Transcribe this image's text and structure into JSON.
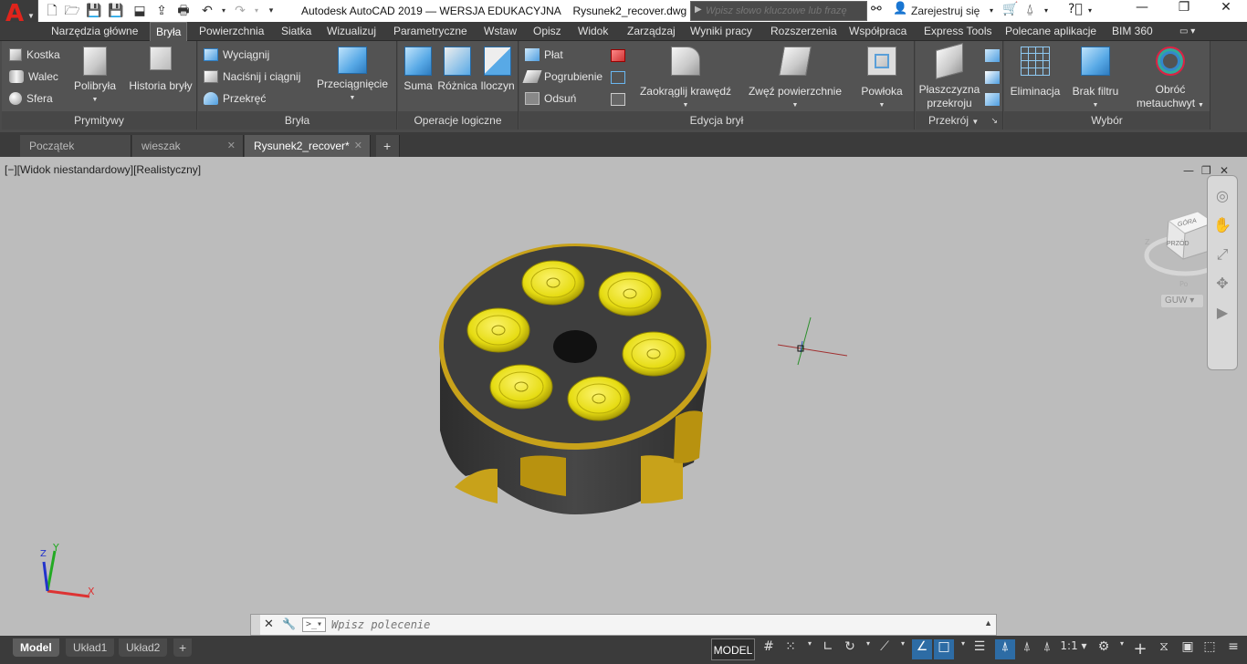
{
  "app": {
    "title": "Autodesk AutoCAD 2019 — WERSJA EDUKACYJNA    Rysunek2_recover.dwg",
    "search_placeholder": "Wpisz słowo kluczowe lub frazę",
    "signin_label": "Zarejestruj się"
  },
  "ribbon_tabs": [
    "Narzędzia główne",
    "Bryła",
    "Powierzchnia",
    "Siatka",
    "Wizualizuj",
    "Parametryczne",
    "Wstaw",
    "Opisz",
    "Widok",
    "Zarządzaj",
    "Wyniki pracy",
    "Rozszerzenia",
    "Współpraca",
    "Express Tools",
    "Polecane aplikacje",
    "BIM 360"
  ],
  "active_tab": "Bryła",
  "panels": {
    "prymitywy": {
      "title": "Prymitywy",
      "items": [
        "Kostka",
        "Walec",
        "Sfera"
      ],
      "large": [
        "Polibryła",
        "Historia bryły"
      ]
    },
    "bryla": {
      "title": "Bryła",
      "items": [
        "Wyciągnij",
        "Naciśnij i ciągnij",
        "Przekręć"
      ],
      "large": [
        "Przeciągnięcie"
      ]
    },
    "operacje": {
      "title": "Operacje logiczne",
      "large": [
        "Suma",
        "Różnica",
        "Iloczyn"
      ]
    },
    "edycja": {
      "title": "Edycja brył",
      "items": [
        "Płat",
        "Pogrubienie",
        "Odsuń"
      ],
      "large": [
        "Zaokrąglij krawędź",
        "Zwęź powierzchnie",
        "Powłoka"
      ]
    },
    "przekroj": {
      "title": "Przekrój",
      "large": [
        "Płaszczyzna",
        "przekroju"
      ]
    },
    "wybor": {
      "title": "Wybór",
      "large": [
        "Eliminacja",
        "Brak filtru",
        "Obróć",
        "metauchwyt"
      ]
    }
  },
  "doc_tabs": [
    "Początek",
    "wieszak",
    "Rysunek2_recover*"
  ],
  "active_doc": "Rysunek2_recover*",
  "viewport": {
    "label": "[−][Widok niestandardowy][Realistyczny]",
    "viewcube": {
      "top": "GÓRA",
      "front": "PRZÓD",
      "compass": "GUW"
    }
  },
  "command": {
    "placeholder": "Wpisz polecenie"
  },
  "layouts": [
    "Model",
    "Układ1",
    "Układ2"
  ],
  "status": {
    "model": "MODEL",
    "scale": "1:1"
  },
  "colors": {
    "accent": "#2d6ca5",
    "gold": "#c8a21a",
    "chip": "#e6dc12",
    "body": "#3e3e3e"
  }
}
